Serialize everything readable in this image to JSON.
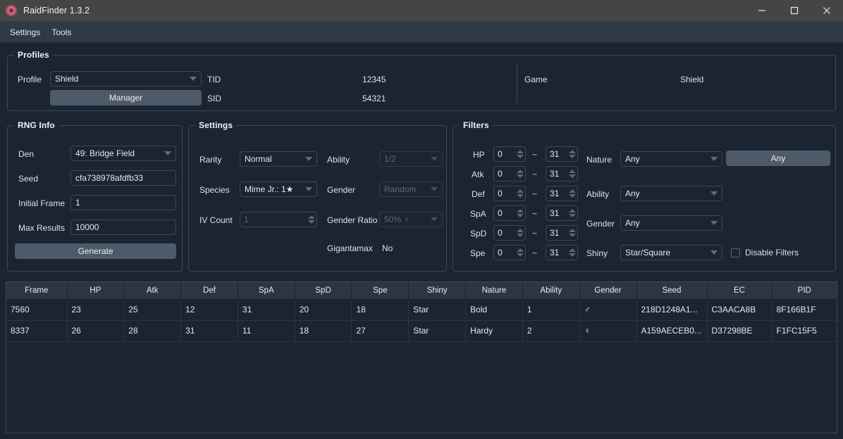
{
  "window": {
    "title": "RaidFinder 1.3.2",
    "icon": "raid-den-icon",
    "minimize": "─",
    "maximize": "□",
    "close": "✕"
  },
  "menubar": {
    "items": [
      "Settings",
      "Tools"
    ]
  },
  "profiles": {
    "title": "Profiles",
    "profile_label": "Profile",
    "profile_value": "Shield",
    "manager_button": "Manager",
    "tid_label": "TID",
    "tid_value": "12345",
    "sid_label": "SID",
    "sid_value": "54321",
    "game_label": "Game",
    "game_value": "Shield"
  },
  "rng_info": {
    "title": "RNG Info",
    "den_label": "Den",
    "den_value": "49: Bridge Field",
    "seed_label": "Seed",
    "seed_value": "cfa738978afdfb33",
    "initial_frame_label": "Initial Frame",
    "initial_frame_value": "1",
    "max_results_label": "Max Results",
    "max_results_value": "10000",
    "generate_button": "Generate"
  },
  "settings": {
    "title": "Settings",
    "rarity_label": "Rarity",
    "rarity_value": "Normal",
    "species_label": "Species",
    "species_value": "Mime Jr.: 1★",
    "iv_count_label": "IV Count",
    "iv_count_value": "1",
    "ability_label": "Ability",
    "ability_value": "1/2",
    "gender_label": "Gender",
    "gender_value": "Random",
    "gender_ratio_label": "Gender Ratio",
    "gender_ratio_value": "50% ♀",
    "gigantamax_label": "Gigantamax",
    "gigantamax_value": "No"
  },
  "filters": {
    "title": "Filters",
    "iv_rows": [
      {
        "label": "HP",
        "min": "0",
        "max": "31"
      },
      {
        "label": "Atk",
        "min": "0",
        "max": "31"
      },
      {
        "label": "Def",
        "min": "0",
        "max": "31"
      },
      {
        "label": "SpA",
        "min": "0",
        "max": "31"
      },
      {
        "label": "SpD",
        "min": "0",
        "max": "31"
      },
      {
        "label": "Spe",
        "min": "0",
        "max": "31"
      }
    ],
    "tilde": "~",
    "nature_label": "Nature",
    "nature_value": "Any",
    "nature_button": "Any",
    "ability_label": "Ability",
    "ability_value": "Any",
    "gender_label": "Gender",
    "gender_value": "Any",
    "shiny_label": "Shiny",
    "shiny_value": "Star/Square",
    "disable_filters_label": "Disable Filters",
    "disable_filters_checked": false
  },
  "results": {
    "columns": [
      "Frame",
      "HP",
      "Atk",
      "Def",
      "SpA",
      "SpD",
      "Spe",
      "Shiny",
      "Nature",
      "Ability",
      "Gender",
      "Seed",
      "EC",
      "PID"
    ],
    "rows": [
      [
        "7560",
        "23",
        "25",
        "12",
        "31",
        "20",
        "18",
        "Star",
        "Bold",
        "1",
        "♂",
        "218D1248A1...",
        "C3AACA8B",
        "8F166B1F"
      ],
      [
        "8337",
        "26",
        "28",
        "31",
        "11",
        "18",
        "27",
        "Star",
        "Hardy",
        "2",
        "♀",
        "A159AECEB0...",
        "D37298BE",
        "F1FC15F5"
      ]
    ]
  },
  "colors": {
    "window_bg": "#1b2430",
    "titlebar_bg": "#454545",
    "menubar_bg": "#2f3a48",
    "accent_button": "#4d5a6a",
    "header_bg": "#2b3643",
    "border": "#3d4857"
  }
}
